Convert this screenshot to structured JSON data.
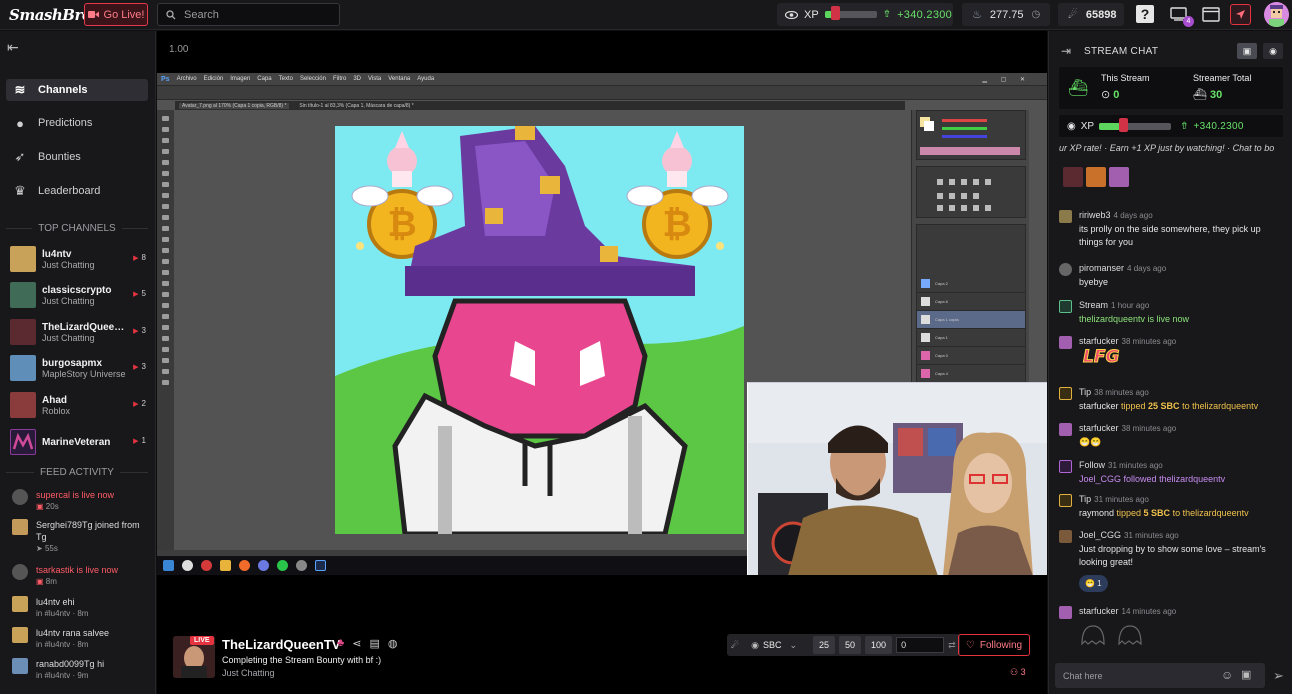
{
  "topbar": {
    "logo_main": "SmashBros",
    "logo_tv": "TV",
    "go_live": "Go Live!",
    "search_placeholder": "Search",
    "xp_label": "XP",
    "xp_progress": 0.2,
    "xp_gain": "+340.2300",
    "coins": "277.75",
    "points": "65898",
    "notif_count": "4"
  },
  "sidebar": {
    "nav": [
      {
        "label": "Channels",
        "icon": "layers-icon"
      },
      {
        "label": "Predictions",
        "icon": "crystal-ball-icon"
      },
      {
        "label": "Bounties",
        "icon": "rocket-icon"
      },
      {
        "label": "Leaderboard",
        "icon": "trophy-icon"
      }
    ],
    "top_channels_title": "TOP CHANNELS",
    "channels": [
      {
        "name": "lu4ntv",
        "category": "Just Chatting",
        "viewers": "8",
        "color": "#c9a25a"
      },
      {
        "name": "classicscrypto",
        "category": "Just Chatting",
        "viewers": "5",
        "color": "#3f6b57"
      },
      {
        "name": "TheLizardQueenTV",
        "category": "Just Chatting",
        "viewers": "3",
        "color": "#5a2a30"
      },
      {
        "name": "burgosapmx",
        "category": "MapleStory Universe",
        "viewers": "3",
        "color": "#5f8fb8"
      },
      {
        "name": "Ahad",
        "category": "Roblox",
        "viewers": "2",
        "color": "#8a3b3b"
      },
      {
        "name": "MarineVeteran",
        "category": "",
        "viewers": "1",
        "color": "#8a3a9a"
      }
    ],
    "feed_title": "FEED ACTIVITY",
    "feed": [
      {
        "user": "supercal",
        "text": " is live now",
        "sub": "20s",
        "live": true,
        "color": "#555"
      },
      {
        "user": "Serghei789Tg",
        "text": " joined from Tg",
        "sub": "55s",
        "live": false,
        "color": "#c49a5a"
      },
      {
        "user": "tsarkastik",
        "text": " is live now",
        "sub": "8m",
        "live": true,
        "color": "#555"
      },
      {
        "user": "lu4ntv",
        "text": " ehi",
        "sub": "in #lu4ntv  · 8m",
        "live": false,
        "color": "#c9a25a"
      },
      {
        "user": "lu4ntv",
        "text": " rana salvee",
        "sub": "in #lu4ntv  · 8m",
        "live": false,
        "color": "#c9a25a"
      },
      {
        "user": "ranabd0099Tg",
        "text": " hi",
        "sub": "in #lu4ntv  · 9m",
        "live": false,
        "color": "#6b8fb5"
      }
    ]
  },
  "main": {
    "zoom": "1.00",
    "ps_menu": [
      "Archivo",
      "Edición",
      "Imagen",
      "Capa",
      "Texto",
      "Selección",
      "Filtro",
      "3D",
      "Vista",
      "Ventana",
      "Ayuda"
    ],
    "ps_tabs": [
      "Avatar_7.png al 170% (Capa 1 copia, RGB/8) *",
      "Sin título-1 al 83,3% (Capa 1, Máscara de capa/8) *"
    ],
    "ps_layers": [
      "Capa 2",
      "Capa 6",
      "Capa 1 copia",
      "Capa 1",
      "Capa 0",
      "Capa 4"
    ]
  },
  "stream": {
    "live_label": "LIVE",
    "streamer": "TheLizardQueenTV",
    "title": "Completing the Stream Bounty with bf :)",
    "category": "Just Chatting",
    "currency": "SBC",
    "amounts": [
      "25",
      "50",
      "100"
    ],
    "custom_amount": "0",
    "follow_label": "Following",
    "followers": "3"
  },
  "chat": {
    "title": "STREAM CHAT",
    "this_stream_label": "This Stream",
    "this_stream_value": "0",
    "streamer_total_label": "Streamer Total",
    "streamer_total_value": "30",
    "xp_label": "XP",
    "xp_progress": 0.33,
    "xp_gain": "+340.2300",
    "ticker_xp": "ur XP rate!",
    "ticker_earn": "Earn +1 XP just by watching!",
    "ticker_chat": "Chat to bo",
    "messages": [
      {
        "user": "ririweb3",
        "time": "4 days ago",
        "body": "its prolly on the side somewhere, they pick up things for you",
        "color": "#8b7a4a"
      },
      {
        "user": "piromanser",
        "time": "4 days ago",
        "body": "byebye",
        "color": "#666"
      },
      {
        "user": "Stream",
        "time": "1 hour ago",
        "body": "thelizardqueentv is live now",
        "color": "#2d6b4b"
      },
      {
        "user": "starfucker",
        "time": "38 minutes ago",
        "body": "LFG",
        "color": "#a25fb0"
      },
      {
        "user": "Tip",
        "time": "38 minutes ago",
        "tip_user": "starfucker",
        "tip_mid": " tipped ",
        "tip_amt": "25 SBC",
        "tip_to": " to ",
        "tip_target": "thelizardqueentv",
        "color": "#c49a30"
      },
      {
        "user": "starfucker",
        "time": "38 minutes ago",
        "body": "😁😁",
        "color": "#a25fb0"
      },
      {
        "user": "Follow",
        "time": "31 minutes ago",
        "follow_user": "Joel_CGG",
        "follow_mid": " followed ",
        "follow_target": "thelizardqueentv",
        "color": "#8a3a9a"
      },
      {
        "user": "Tip",
        "time": "31 minutes ago",
        "tip_user": "raymond",
        "tip_mid": " tipped ",
        "tip_amt": "5 SBC",
        "tip_to": " to ",
        "tip_target": "thelizardqueentv",
        "color": "#c49a30"
      },
      {
        "user": "Joel_CGG",
        "time": "31 minutes ago",
        "body": "Just dropping by to show some love – stream's looking great!",
        "reaction": "😁 1",
        "color": "#7a5a3a"
      },
      {
        "user": "starfucker",
        "time": "14 minutes ago",
        "body": "",
        "color": "#a25fb0"
      }
    ],
    "input_placeholder": "Chat here"
  }
}
